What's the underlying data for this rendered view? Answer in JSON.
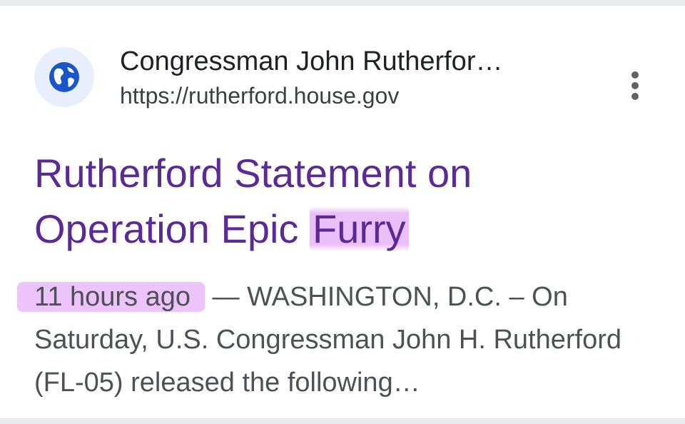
{
  "result": {
    "source_name": "Congressman John Rutherfor…",
    "url": "https://rutherford.house.gov",
    "favicon_icon": "globe-icon",
    "more_icon": "more-vert-icon",
    "title_before": "Rutherford Statement on Operation Epic ",
    "title_highlight": "Furry",
    "time": "11 hours ago",
    "snippet": " — WASHINGTON, D.C. – On Saturday, U.S. Congressman John H. Rutherford (FL-05) released the following…",
    "colors": {
      "title": "#5b2a96",
      "highlight": "#e4aaf8",
      "favicon_bg": "#e8eefb",
      "globe": "#1a56c8"
    }
  }
}
